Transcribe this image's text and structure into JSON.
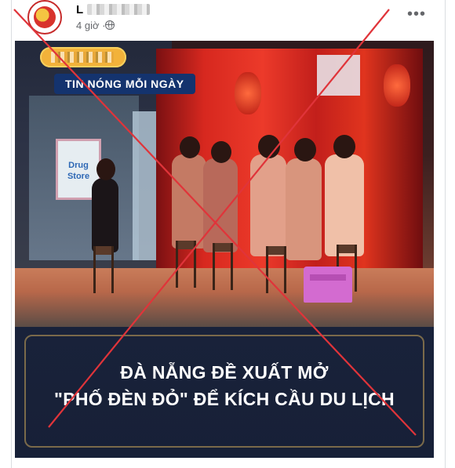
{
  "post": {
    "author_initial": "L",
    "time": "4 giờ ·",
    "privacy_icon": "globe-icon",
    "more_icon": "more-dots-icon"
  },
  "image": {
    "tag": "TIN NÓNG MỖI NGÀY",
    "shop_sign": "Drug Store",
    "headline_line1": "ĐÀ NẴNG ĐỀ XUẤT MỞ",
    "headline_line2": "\"PHỐ ĐÈN ĐỎ\" ĐỂ KÍCH CẦU DU LỊCH"
  },
  "overlay": {
    "type": "red-x-cross",
    "color": "#e0343a"
  }
}
